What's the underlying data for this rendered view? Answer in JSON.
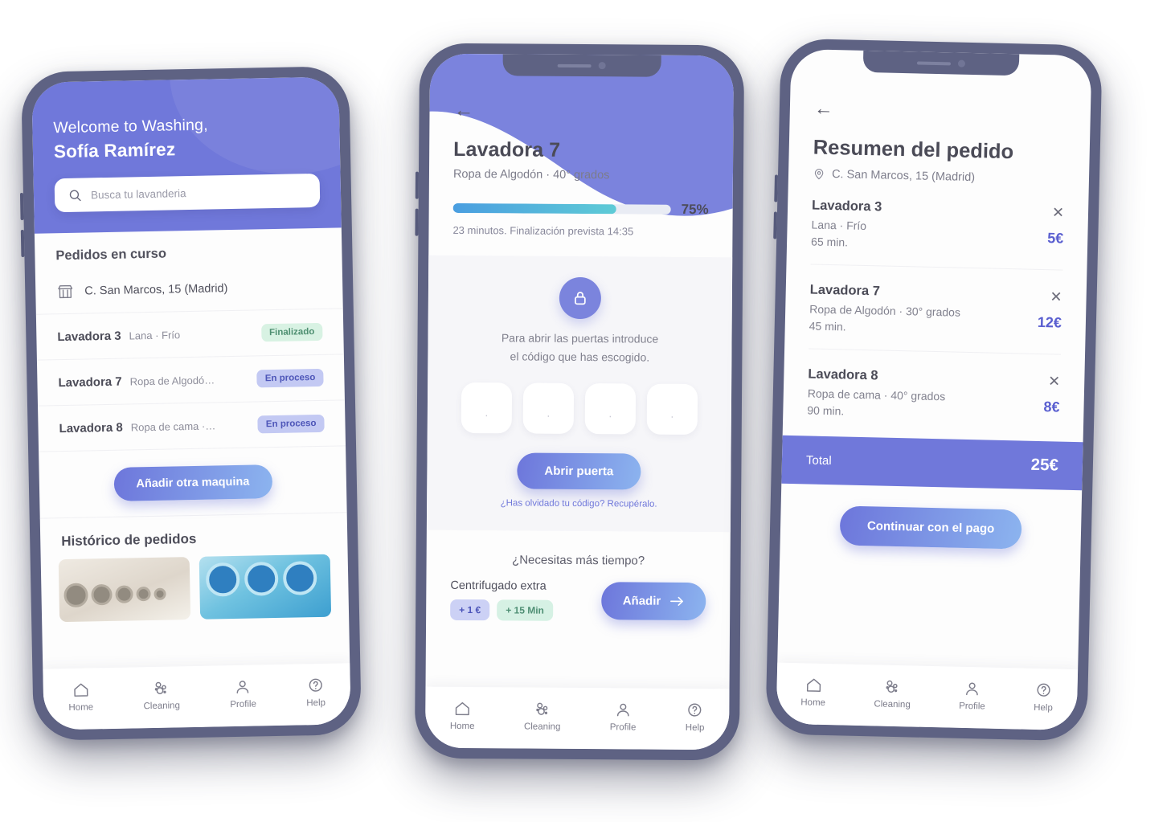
{
  "brand": {
    "purple": "#7078da",
    "purple_dark": "#6d76db",
    "blue": "#8cb4ef",
    "green": "#d8f2e3",
    "accent_text": "#5a5fd0"
  },
  "nav": {
    "items": [
      {
        "label": "Home",
        "icon": "home-icon"
      },
      {
        "label": "Cleaning",
        "icon": "bubbles-icon"
      },
      {
        "label": "Profile",
        "icon": "person-icon"
      },
      {
        "label": "Help",
        "icon": "question-circle-icon"
      }
    ]
  },
  "phone1": {
    "welcome_greeting": "Welcome to Washing,",
    "user_name": "Sofía Ramírez",
    "search": {
      "placeholder": "Busca tu lavanderia",
      "value": "",
      "icon": "search-icon"
    },
    "orders_section_title": "Pedidos en curso",
    "address": {
      "icon": "store-icon",
      "text": "C. San Marcos, 15 (Madrid)"
    },
    "orders": [
      {
        "machine": "Lavadora 3",
        "desc": "Lana · Frío",
        "status": "Finalizado",
        "status_type": "done"
      },
      {
        "machine": "Lavadora 7",
        "desc": "Ropa de Algodó…",
        "status": "En proceso",
        "status_type": "progress"
      },
      {
        "machine": "Lavadora 8",
        "desc": "Ropa de cama ·…",
        "status": "En proceso",
        "status_type": "progress"
      }
    ],
    "add_machine_label": "Añadir otra maquina",
    "history_title": "Histórico de pedidos"
  },
  "phone2": {
    "back_icon": "back-arrow-icon",
    "title": "Lavadora 7",
    "subtitle": "Ropa de Algodón · 40° grados",
    "progress": {
      "percent": 75,
      "percent_label": "75%",
      "note": "23 minutos. Finalización prevista 14:35"
    },
    "lock_icon": "lock-icon",
    "lock_text_line1": "Para abrir las puertas introduce",
    "lock_text_line2": "el código que has escogido.",
    "code_boxes": [
      "·",
      "·",
      "·",
      "·"
    ],
    "open_door_label": "Abrir puerta",
    "recover_link": "¿Has olvidado tu código? Recupéralo.",
    "more_time_label": "¿Necesitas más tiempo?",
    "extra": {
      "title": "Centrifugado extra",
      "chip_price": "+ 1 €",
      "chip_time": "+ 15 Min",
      "add_label": "Añadir",
      "add_icon": "arrow-right-icon"
    }
  },
  "phone3": {
    "back_icon": "back-arrow-icon",
    "title": "Resumen del pedido",
    "address": {
      "icon": "location-pin-icon",
      "text": "C. San Marcos, 15 (Madrid)"
    },
    "items": [
      {
        "machine": "Lavadora 3",
        "desc": "Lana · Frío",
        "duration": "65 min.",
        "price": "5€",
        "remove_icon": "close-icon"
      },
      {
        "machine": "Lavadora 7",
        "desc": "Ropa de Algodón · 30° grados",
        "duration": "45 min.",
        "price": "12€",
        "remove_icon": "close-icon"
      },
      {
        "machine": "Lavadora 8",
        "desc": "Ropa de cama · 40° grados",
        "duration": "90 min.",
        "price": "8€",
        "remove_icon": "close-icon"
      }
    ],
    "total_label": "Total",
    "total_value": "25€",
    "pay_label": "Continuar con el pago"
  }
}
